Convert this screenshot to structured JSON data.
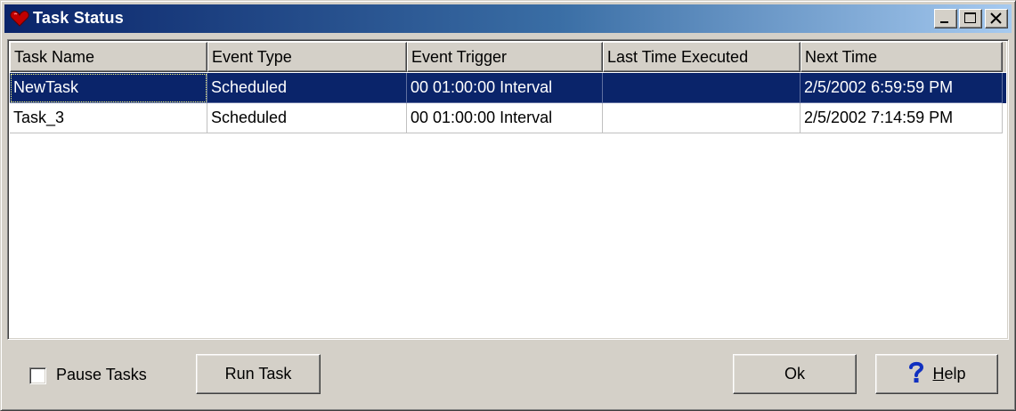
{
  "window": {
    "title": "Task Status"
  },
  "table": {
    "columns": [
      "Task Name",
      "Event Type",
      "Event Trigger",
      "Last Time Executed",
      "Next Time"
    ],
    "rows": [
      {
        "task_name": "NewTask",
        "event_type": "Scheduled",
        "event_trigger": "00 01:00:00 Interval",
        "last_time_executed": "",
        "next_time": "2/5/2002 6:59:59 PM",
        "selected": true
      },
      {
        "task_name": "Task_3",
        "event_type": "Scheduled",
        "event_trigger": "00 01:00:00 Interval",
        "last_time_executed": "",
        "next_time": "2/5/2002 7:14:59 PM",
        "selected": false
      }
    ]
  },
  "controls": {
    "pause_tasks_label": "Pause Tasks",
    "pause_tasks_checked": false,
    "run_task_label": "Run Task",
    "ok_label": "Ok",
    "help_mnemonic": "H",
    "help_rest": "elp"
  },
  "icons": {
    "app": "heart-app-icon",
    "minimize": "minimize-icon",
    "maximize": "maximize-icon",
    "close": "close-icon",
    "help": "question-mark-icon"
  },
  "colors": {
    "title_gradient_start": "#0a246a",
    "title_gradient_end": "#a6caf0",
    "selection": "#0a246a",
    "face": "#d4d0c8"
  }
}
